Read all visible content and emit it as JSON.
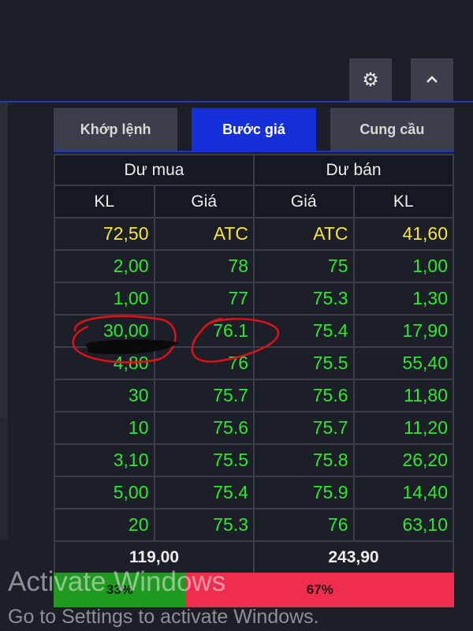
{
  "toolbar": {
    "settings_icon": "gear-icon",
    "collapse_icon": "chevron-up-icon"
  },
  "tabs": [
    {
      "label": "Khớp lệnh",
      "active": false
    },
    {
      "label": "Bước giá",
      "active": true
    },
    {
      "label": "Cung cầu",
      "active": false
    }
  ],
  "headers": {
    "buy_group": "Dư mua",
    "sell_group": "Dư bán",
    "buy_vol": "KL",
    "buy_price": "Giá",
    "sell_price": "Giá",
    "sell_vol": "KL"
  },
  "rows": [
    {
      "buy_vol": "72,50",
      "buy_price": "ATC",
      "sell_price": "ATC",
      "sell_vol": "41,60"
    },
    {
      "buy_vol": "2,00",
      "buy_price": "78",
      "sell_price": "75",
      "sell_vol": "1,00"
    },
    {
      "buy_vol": "1,00",
      "buy_price": "77",
      "sell_price": "75.3",
      "sell_vol": "1,30"
    },
    {
      "buy_vol": "30,00",
      "buy_price": "76.1",
      "sell_price": "75.4",
      "sell_vol": "17,90"
    },
    {
      "buy_vol": "4,80",
      "buy_price": "76",
      "sell_price": "75.5",
      "sell_vol": "55,40"
    },
    {
      "buy_vol": "30",
      "buy_price": "75.7",
      "sell_price": "75.6",
      "sell_vol": "11,80"
    },
    {
      "buy_vol": "10",
      "buy_price": "75.6",
      "sell_price": "75.7",
      "sell_vol": "11,20"
    },
    {
      "buy_vol": "3,10",
      "buy_price": "75.5",
      "sell_price": "75.8",
      "sell_vol": "26,20"
    },
    {
      "buy_vol": "5,00",
      "buy_price": "75.4",
      "sell_price": "75.9",
      "sell_vol": "14,40"
    },
    {
      "buy_vol": "20",
      "buy_price": "75.3",
      "sell_price": "76",
      "sell_vol": "63,10"
    }
  ],
  "totals": {
    "buy": "119,00",
    "sell": "243,90"
  },
  "ratio": {
    "buy_label": "33%",
    "sell_label": "67%",
    "buy_fraction": 0.33
  },
  "colors": {
    "accent": "#1530d8",
    "up": "#2ee82e",
    "atc": "#f5e63c",
    "buy_bar": "#1f9a1f",
    "sell_bar": "#ef2d4f"
  },
  "watermark": {
    "title": "Activate Windows",
    "subtitle": "Go to Settings to activate Windows."
  }
}
